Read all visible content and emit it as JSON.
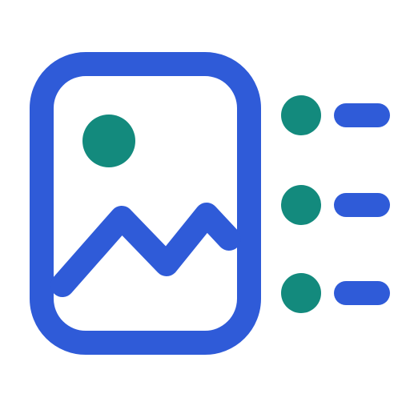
{
  "icon": {
    "name": "image-list-icon",
    "colors": {
      "frame": "#2f5bd8",
      "accent": "#138a7d"
    },
    "list_items": [
      {
        "name": "bullet-1"
      },
      {
        "name": "bullet-2"
      },
      {
        "name": "bullet-3"
      }
    ]
  }
}
